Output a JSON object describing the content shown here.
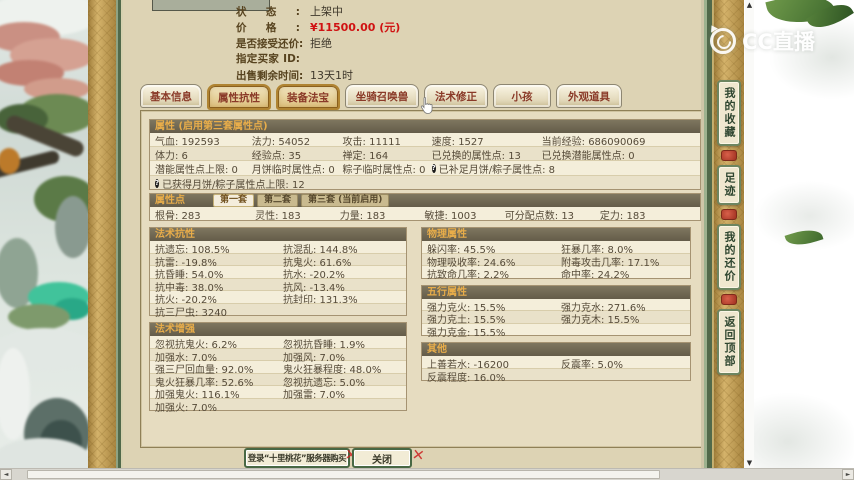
{
  "watermark": {
    "brand": "CC直播"
  },
  "colors": {
    "price_red": "#d01212",
    "section_header_text": "#e8ad4a",
    "tab_text": "#8a3a28",
    "seal_red": "#cc2020"
  },
  "listing": {
    "rows": [
      {
        "label": "状态:",
        "value": "上架中"
      },
      {
        "label": "价格:",
        "value": "¥11500.00 (元)",
        "cls": "price"
      },
      {
        "label": "是否接受还价:",
        "value": "拒绝"
      },
      {
        "label": "指定买家 ID:",
        "value": ""
      },
      {
        "label": "出售剩余时间:",
        "value": "13天1时"
      }
    ]
  },
  "tabs": [
    {
      "label": "基本信息",
      "state": ""
    },
    {
      "label": "属性抗性",
      "state": "active"
    },
    {
      "label": "装备法宝",
      "state": "active"
    },
    {
      "label": "坐骑召唤兽",
      "state": ""
    },
    {
      "label": "法术修正",
      "state": ""
    },
    {
      "label": "小孩",
      "state": ""
    },
    {
      "label": "外观道具",
      "state": ""
    }
  ],
  "attributes": {
    "title": "属性 (启用第三套属性点)",
    "rows": [
      [
        {
          "label": "气血",
          "value": "192593"
        },
        {
          "label": "法力",
          "value": "54052"
        },
        {
          "label": "攻击",
          "value": "11111"
        },
        {
          "label": "速度",
          "value": "1527"
        },
        {
          "label": "当前经验",
          "value": "686090069"
        }
      ],
      [
        {
          "label": "体力",
          "value": "6"
        },
        {
          "label": "经验点",
          "value": "35"
        },
        {
          "label": "禅定",
          "value": "164"
        },
        {
          "label": "已兑换的属性点",
          "value": "13"
        },
        {
          "label": "已兑换潜能属性点",
          "value": "0"
        }
      ],
      [
        {
          "label": "潜能属性点上限",
          "value": "0"
        },
        {
          "label": "月饼临时属性点",
          "value": "0"
        },
        {
          "label": "粽子临时属性点",
          "value": "0"
        },
        {
          "label": "已补足月饼/粽子属性点",
          "value": "8",
          "help": true
        }
      ],
      [
        {
          "label": "已获得月饼/粽子属性点上限",
          "value": "12",
          "help": true
        }
      ]
    ]
  },
  "attribute_points": {
    "title": "属性点",
    "sets": [
      {
        "label": "第一套",
        "state": "active"
      },
      {
        "label": "第二套",
        "state": ""
      },
      {
        "label": "第三套 (当前启用)",
        "state": ""
      }
    ],
    "rows": [
      [
        {
          "label": "根骨",
          "value": "283"
        },
        {
          "label": "灵性",
          "value": "183"
        },
        {
          "label": "力量",
          "value": "183"
        },
        {
          "label": "敏捷",
          "value": "1003"
        },
        {
          "label": "可分配点数",
          "value": "13"
        },
        {
          "label": "定力",
          "value": "183"
        }
      ]
    ]
  },
  "magic_resist": {
    "title": "法术抗性",
    "rows": [
      [
        {
          "label": "抗遗忘",
          "value": "108.5%"
        },
        {
          "label": "抗混乱",
          "value": "144.8%"
        }
      ],
      [
        {
          "label": "抗雷",
          "value": "-19.8%"
        },
        {
          "label": "抗鬼火",
          "value": "61.6%"
        }
      ],
      [
        {
          "label": "抗昏睡",
          "value": "54.0%"
        },
        {
          "label": "抗水",
          "value": "-20.2%"
        }
      ],
      [
        {
          "label": "抗中毒",
          "value": "38.0%"
        },
        {
          "label": "抗风",
          "value": "-13.4%"
        }
      ],
      [
        {
          "label": "抗火",
          "value": "-20.2%"
        },
        {
          "label": "抗封印",
          "value": "131.3%"
        }
      ],
      [
        {
          "label": "抗三尸虫",
          "value": "3240"
        }
      ]
    ]
  },
  "magic_enhance": {
    "title": "法术增强",
    "rows": [
      [
        {
          "label": "忽视抗鬼火",
          "value": "6.2%"
        },
        {
          "label": "忽视抗昏睡",
          "value": "1.9%"
        }
      ],
      [
        {
          "label": "加强水",
          "value": "7.0%"
        },
        {
          "label": "加强风",
          "value": "7.0%"
        }
      ],
      [
        {
          "label": "强三尸回血量",
          "value": "92.0%"
        },
        {
          "label": "鬼火狂暴程度",
          "value": "48.0%"
        }
      ],
      [
        {
          "label": "鬼火狂暴几率",
          "value": "52.6%"
        },
        {
          "label": "忽视抗遗忘",
          "value": "5.0%"
        }
      ],
      [
        {
          "label": "加强鬼火",
          "value": "116.1%"
        },
        {
          "label": "加强雷",
          "value": "7.0%"
        }
      ],
      [
        {
          "label": "加强火",
          "value": "7.0%"
        }
      ]
    ]
  },
  "physical": {
    "title": "物理属性",
    "rows": [
      [
        {
          "label": "躲闪率",
          "value": "45.5%"
        },
        {
          "label": "狂暴几率",
          "value": "8.0%"
        }
      ],
      [
        {
          "label": "物理吸收率",
          "value": "24.6%"
        },
        {
          "label": "附毒攻击几率",
          "value": "17.1%"
        }
      ],
      [
        {
          "label": "抗致命几率",
          "value": "2.2%"
        },
        {
          "label": "命中率",
          "value": "24.2%"
        }
      ]
    ]
  },
  "five_elements": {
    "title": "五行属性",
    "rows": [
      [
        {
          "label": "强力克火",
          "value": "15.5%"
        },
        {
          "label": "强力克水",
          "value": "271.6%"
        }
      ],
      [
        {
          "label": "强力克土",
          "value": "15.5%"
        },
        {
          "label": "强力克木",
          "value": "15.5%"
        }
      ],
      [
        {
          "label": "强力克金",
          "value": "15.5%"
        }
      ]
    ]
  },
  "other": {
    "title": "其他",
    "rows": [
      [
        {
          "label": "上善若水",
          "value": "-16200"
        },
        {
          "label": "反震率",
          "value": "5.0%"
        }
      ],
      [
        {
          "label": "反震程度",
          "value": "16.0%"
        }
      ]
    ]
  },
  "side_tabs": [
    {
      "label": "我的收藏"
    },
    {
      "label": "足迹"
    },
    {
      "label": "我的还价"
    },
    {
      "label": "返回顶部"
    }
  ],
  "footer": {
    "login_label": "登录“十里桃花”服务器购买",
    "close_label": "关闭"
  }
}
